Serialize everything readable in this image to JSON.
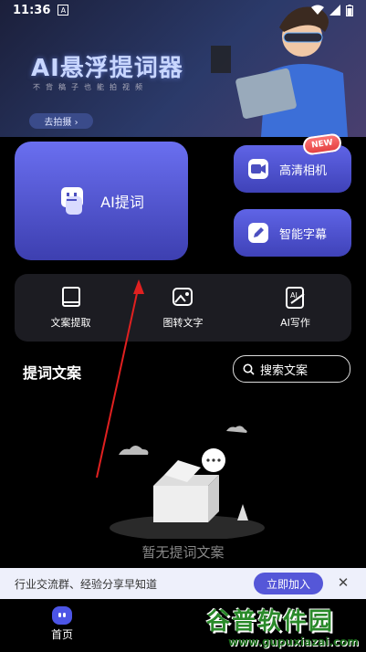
{
  "status_bar": {
    "time": "11:36",
    "notif_icon": "A"
  },
  "banner": {
    "title": "AI悬浮提词器",
    "subtitle": "不背稿子也能拍视频",
    "cta_label": "去拍摄 ›"
  },
  "cards": {
    "ai_prompter_label": "AI提词",
    "camera_label": "高清相机",
    "subtitles_label": "智能字幕",
    "new_badge": "NEW"
  },
  "tools": [
    {
      "label": "文案提取",
      "icon": "book-icon"
    },
    {
      "label": "图转文字",
      "icon": "image-text-icon"
    },
    {
      "label": "AI写作",
      "icon": "ai-pen-icon"
    }
  ],
  "section": {
    "title": "提词文案",
    "search_label": "搜索文案"
  },
  "empty_state": {
    "text": "暂无提词文案"
  },
  "promo": {
    "text": "行业交流群、经验分享早知道",
    "join_label": "立即加入",
    "close": "✕"
  },
  "bottom_nav": {
    "home_label": "首页"
  },
  "watermark": {
    "title": "谷普软件园",
    "url": "www.gupuxiazai.com"
  },
  "colors": {
    "accent": "#5557d8",
    "card": "#6a6ff0",
    "arrow": "#e02020"
  }
}
